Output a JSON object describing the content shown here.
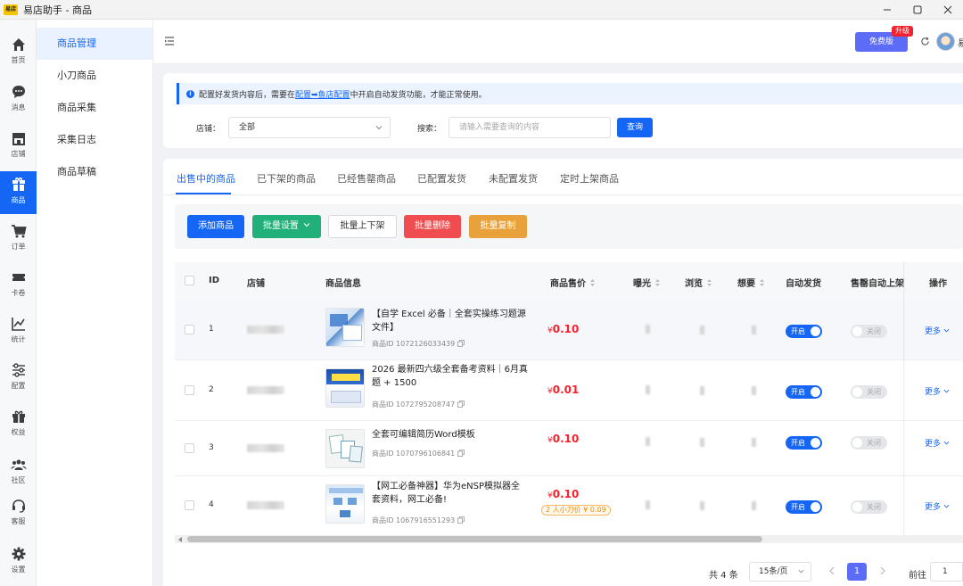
{
  "window": {
    "title": "易店助手 - 商品",
    "logo_text": "易店",
    "controls": [
      "—",
      "▢",
      "✕"
    ]
  },
  "rail": [
    {
      "label": "首页",
      "icon": "home-icon"
    },
    {
      "label": "消息",
      "icon": "chat-icon"
    },
    {
      "label": "店铺",
      "icon": "store-icon"
    },
    {
      "label": "商品",
      "icon": "package-icon",
      "active": true
    },
    {
      "label": "订单",
      "icon": "cart-icon"
    },
    {
      "label": "卡卷",
      "icon": "ticket-icon"
    },
    {
      "label": "统计",
      "icon": "chart-icon"
    },
    {
      "label": "配置",
      "icon": "sliders-icon"
    },
    {
      "label": "权益",
      "icon": "gift-icon"
    },
    {
      "label": "社区",
      "icon": "community-icon"
    },
    {
      "label": "客服",
      "icon": "headset-icon"
    },
    {
      "label": "设置",
      "icon": "gear-icon"
    }
  ],
  "subnav": [
    {
      "label": "商品管理",
      "active": true
    },
    {
      "label": "小刀商品"
    },
    {
      "label": "商品采集"
    },
    {
      "label": "采集日志"
    },
    {
      "label": "商品草稿"
    }
  ],
  "header": {
    "upgrade_label": "免费版",
    "upgrade_badge": "升级",
    "user_name": "易"
  },
  "notice": {
    "prefix": "配置好发货内容后，需要在",
    "link": "配置➡鱼店配置",
    "suffix": "中开启自动发货功能，才能正常使用。"
  },
  "filters": {
    "store_label": "店铺：",
    "store_value": "全部",
    "search_label": "搜索：",
    "search_placeholder": "请输入需要查询的内容",
    "query_label": "查询"
  },
  "tabs": [
    {
      "label": "出售中的商品",
      "active": true
    },
    {
      "label": "已下架的商品"
    },
    {
      "label": "已经售罄商品"
    },
    {
      "label": "已配置发货"
    },
    {
      "label": "未配置发货"
    },
    {
      "label": "定时上架商品"
    }
  ],
  "toolbar": {
    "add": "添加商品",
    "batch_settings": "批量设置",
    "batch_toggle": "批量上下架",
    "batch_delete": "批量删除",
    "batch_copy": "批量复制",
    "colors": {
      "add": "#1666f5",
      "settings": "#21b07a",
      "delete": "#ef4d4f",
      "copy": "#e9a23b"
    }
  },
  "table": {
    "columns": {
      "id": "ID",
      "store": "店铺",
      "info": "商品信息",
      "price": "商品售价",
      "exposure": "曝光",
      "views": "浏览",
      "wants": "想要",
      "auto_ship": "自动发货",
      "auto_relist": "售罄自动上架",
      "actions": "操作"
    },
    "rows": [
      {
        "id": "1",
        "title": "【自学 Excel 必备｜全套实操练习题源文件】",
        "pid": "商品ID 1072126033439",
        "currency": "¥",
        "price": "0.10",
        "auto_ship": "开启",
        "auto_relist": "关闭",
        "more": "更多"
      },
      {
        "id": "2",
        "title": "2026 最新四六级全套备考资料｜6月真题 + 1500",
        "pid": "商品ID 1072795208747",
        "currency": "¥",
        "price": "0.01",
        "auto_ship": "开启",
        "auto_relist": "关闭",
        "more": "更多"
      },
      {
        "id": "3",
        "title": "全套可编辑简历Word模板",
        "pid": "商品ID 1070796106841",
        "currency": "¥",
        "price": "0.10",
        "auto_ship": "开启",
        "auto_relist": "关闭",
        "more": "更多"
      },
      {
        "id": "4",
        "title": "【网工必备神器】华为eNSP模拟器全套资料，网工必备!",
        "pid": "商品ID 1067916551293",
        "currency": "¥",
        "price": "0.10",
        "discount": "2 人小刀价 ¥ 0.09",
        "auto_ship": "开启",
        "auto_relist": "关闭",
        "more": "更多"
      }
    ]
  },
  "pagination": {
    "total": "共 4 条",
    "page_size": "15条/页",
    "current_page": "1",
    "goto_label": "前往",
    "goto_value": "1"
  }
}
